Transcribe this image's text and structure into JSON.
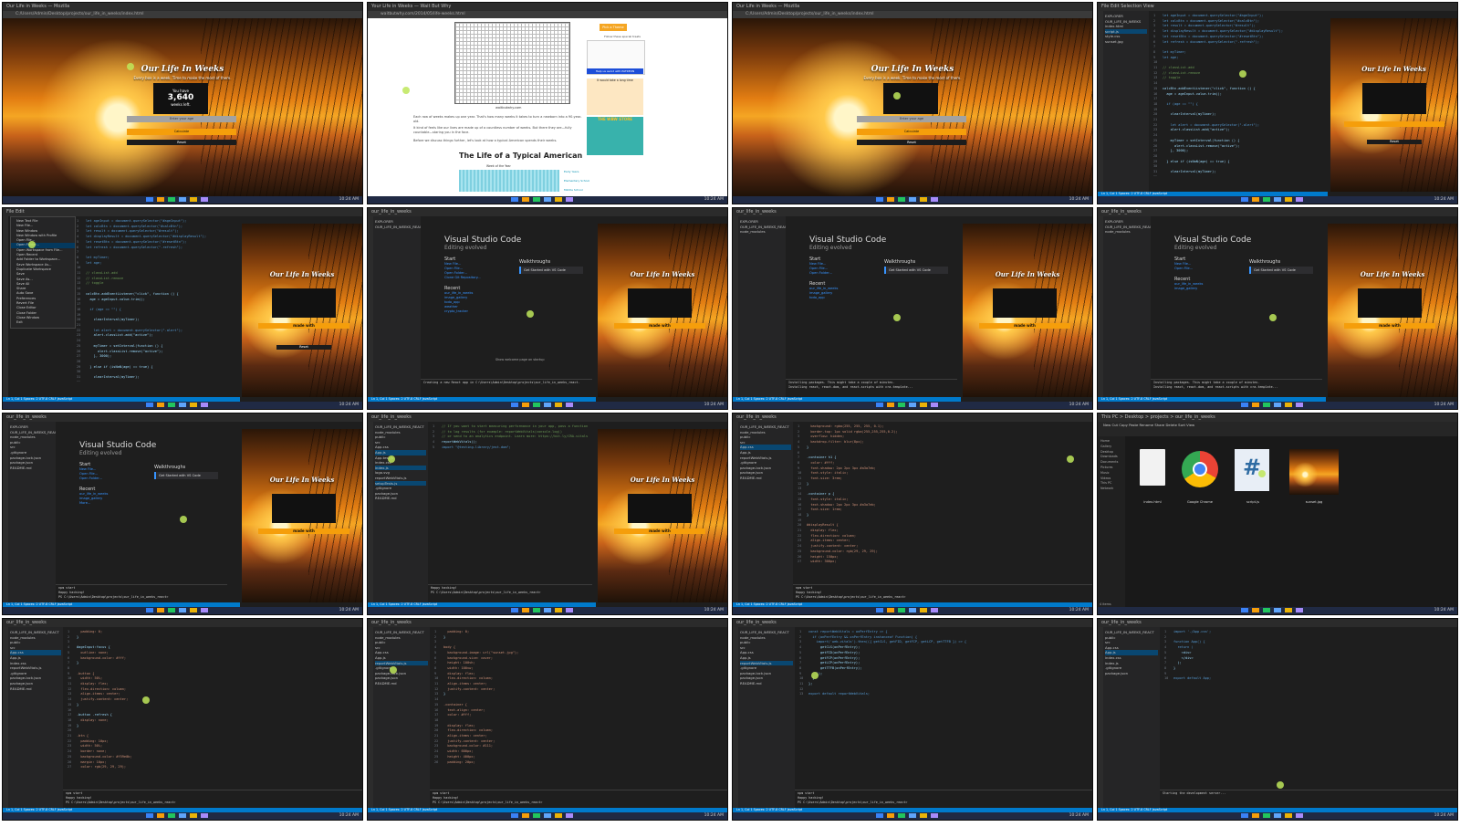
{
  "app": {
    "title": "Our Life In Weeks",
    "subtitle": "Every box is a week. Time to make the most of them.",
    "weeks_label": "You have",
    "weeks_value": "3,640",
    "weeks_suffix": "weeks left.",
    "input_placeholder": "Enter your age",
    "submit_label": "Calculate",
    "reset_label": "Reset",
    "title_alt": "Our Life In Weeks",
    "made_with": "made with"
  },
  "browser": {
    "tab_title": "Our Life in Weeks — Mozilla",
    "tab_title_2": "Your Life in Weeks — Wait But Why",
    "url_local": "C:/Users/Admin/Desktop/projects/our_life_in_weeks/index.html",
    "url_article": "waitbutwhy.com/2014/05/life-weeks.html",
    "article_caption": "waitbutwhy.com",
    "article_text_1": "Each row of weeks makes up one year. That's how many weeks it takes to turn a newborn into a 90-year-old.",
    "article_text_2": "It kind of feels like our lives are made up of a countless number of weeks. But there they are—fully countable—staring you in the face.",
    "article_text_3": "Before we discuss things further, let's look at how a typical American spends their weeks.",
    "article_heading": "The Life of a Typical American",
    "article_axis_label": "Week of the Year",
    "article_legend_1": "Early Years",
    "article_legend_2": "Elementary School",
    "article_legend_3": "Middle School",
    "side_banner": "Pick a Theme",
    "side_comic_caption": "Help us avoid with PATREON",
    "side_comic_2": "It would take a long time",
    "side_store": "THE WBW STORE",
    "side_tagline": "Follow these special treats"
  },
  "vscode": {
    "menu": [
      "File",
      "Edit",
      "Selection",
      "View",
      "Go",
      "Run",
      "Terminal",
      "Help"
    ],
    "search_placeholder": "our_life_in_weeks",
    "explorer_title": "EXPLORER",
    "project_name": "OUR_LIFE_IN_WEEKS_REACT",
    "project_name_2": "OUR_LIFE_IN_WEEKS",
    "files_root": [
      "index.html",
      "script.js",
      "style.css",
      "sunset.jpg"
    ],
    "files_react": [
      "node_modules",
      "public",
      "src",
      "App.css",
      "App.js",
      "App.test.js",
      "index.css",
      "index.js",
      "logo.svg",
      "reportWebVitals.js",
      "setupTests.js",
      ".gitignore",
      "package-lock.json",
      "package.json",
      "README.md"
    ],
    "outline": "OUTLINE",
    "timeline": "TIMELINE",
    "welcome_title": "Visual Studio Code",
    "welcome_sub": "Editing evolved",
    "start": "Start",
    "start_items": [
      "New File...",
      "Open File...",
      "Open Folder...",
      "Clone Git Repository..."
    ],
    "recent": "Recent",
    "recent_items": [
      "our_life_in_weeks",
      "image_gallery",
      "todo_app",
      "weather",
      "crypto_tracker"
    ],
    "more": "More...",
    "walkthroughs": "Walkthroughs",
    "walk_card_title": "Get Started with VS Code",
    "walk_card_text": "Customize your editor, learn the basics, and start coding",
    "show_welcome": "Show welcome page on startup",
    "terminal_tabs": [
      "PROBLEMS",
      "OUTPUT",
      "DEBUG CONSOLE",
      "TERMINAL",
      "PORTS"
    ],
    "term_1": "Creating a new React app in C:\\Users\\Admin\\Desktop\\projects\\our_life_in_weeks_react.",
    "term_2": "Installing packages. This might take a couple of minutes.",
    "term_3": "Installing react, react-dom, and react-scripts with cra-template...",
    "term_4": "Happy hacking!",
    "term_5": "PS C:\\Users\\Admin\\Desktop\\projects\\our_life_in_weeks_react>",
    "term_6": "npm start",
    "term_7": "Starting the development server...",
    "status_left": "main",
    "status_right": "Ln 1, Col 1   Spaces: 2   UTF-8   CRLF   JavaScript",
    "tab_files": [
      "App.js",
      "App.css",
      "index.js",
      "reportWebVitals.js",
      "setupTests.js"
    ],
    "file_menu": [
      "New Text File",
      "New File...",
      "New Window",
      "New Window with Profile",
      "Open File...",
      "Open Folder...",
      "Open Workspace from File...",
      "Open Recent",
      "Add Folder to Workspace...",
      "Save Workspace As...",
      "Duplicate Workspace",
      "Save",
      "Save As...",
      "Save All",
      "Share",
      "Auto Save",
      "Preferences",
      "Revert File",
      "Close Editor",
      "Close Folder",
      "Close Window",
      "Exit"
    ]
  },
  "code": {
    "script_js": [
      "let ageInput = document.querySelector(\"#ageInput\");",
      "let calcBtn = document.querySelector(\"#calcBtn\");",
      "let result = document.querySelector(\"#result\");",
      "let displayResult = document.querySelector(\"#displayResult\");",
      "let resetBtn = document.querySelector(\"#resetBtn\");",
      "let refresh = document.querySelector(\".refresh\");",
      "",
      "let myTimer;",
      "let age;",
      "",
      "// classList.add",
      "// classList.remove",
      "// toggle",
      "",
      "calcBtn.addEventListener(\"click\", function () {",
      "  age = ageInput.value.trim();",
      "",
      "  if (age == \"\") {",
      "",
      "    clearInterval(myTimer);",
      "",
      "    let alert = document.querySelector(\".alert\");",
      "    alert.classList.add(\"active\");",
      "",
      "    myTimer = setInterval(function () {",
      "      alert.classList.remove(\"active\");",
      "    }, 3000);",
      "",
      "  } else if (isNaN(age) == true) {",
      "",
      "    clearInterval(myTimer);",
      "",
      "    let alert = document.querySelector(\".alert\");"
    ],
    "app_js_comment": [
      "// If you want to start measuring performance in your app, pass a function",
      "// to log results (for example: reportWebVitals(console.log))",
      "// or send to an analytics endpoint. Learn more: https://bit.ly/CRA-vitals",
      "reportWebVitals();",
      "import \"@testing-library/jest-dom\";"
    ],
    "css_a": [
      "  background: rgba(255, 255, 255, 0.1);",
      "  border-top: 1px solid rgba(255,255,255,0.2);",
      "  overflow: hidden;",
      "  backdrop-filter: blur(8px);",
      "}",
      "",
      ".container h1 {",
      "  color: #fff;",
      "  font-shadow: 2px 2px 3px #a3a7eb;",
      "  font-style: italic;",
      "  font-size: 3rem;",
      "}",
      "",
      ".container p {",
      "  font-style: italic;",
      "  text-shadow: 2px 2px 3px #a3a7eb;",
      "  font-size: 1rem;",
      "}",
      "",
      "#displayResult {",
      "  display: flex;",
      "  flex-direction: column;",
      "  align-items: center;",
      "  justify-content: center;",
      "  background-color: rgb(29, 29, 29);",
      "  height: 150px;",
      "  width: 300px;"
    ],
    "css_b": [
      "  padding: 0;",
      "}",
      "",
      "#ageInput:focus {",
      "  outline: none;",
      "  background-color: #fff;",
      "}",
      "",
      ".button {",
      "  width: 50%;",
      "  display: flex;",
      "  flex-direction: column;",
      "  align-items: center;",
      "  justify-content: center;",
      "}",
      "",
      ".button .refresh {",
      "  display: none;",
      "}",
      "",
      ".btn {",
      "  padding: 10px;",
      "  width: 50%;",
      "  border: none;",
      "  background-color: #f59e0b;",
      "  margin: 10px;",
      "  color: rgb(29, 29, 29);"
    ],
    "css_c": [
      "  padding: 0;",
      "}",
      "",
      "body {",
      "  background-image: url(\"sunset.jpg\");",
      "  background-size: cover;",
      "  height: 100vh;",
      "  width: 100vw;",
      "  display: flex;",
      "  flex-direction: column;",
      "  align-items: center;",
      "  justify-content: center;",
      "}",
      "",
      ".container {",
      "  text-align: center;",
      "  color: #fff;",
      "",
      "  display: flex;",
      "  flex-direction: column;",
      "  align-items: center;",
      "  justify-content: center;",
      "  background-color: #111;",
      "  width: 600px;",
      "  height: 400px;",
      "  padding: 20px;"
    ],
    "vitals_js": [
      "const reportWebVitals = onPerfEntry => {",
      "  if (onPerfEntry && onPerfEntry instanceof Function) {",
      "    import('web-vitals').then(({ getCLS, getFID, getFCP, getLCP, getTTFB }) => {",
      "      getCLS(onPerfEntry);",
      "      getFID(onPerfEntry);",
      "      getFCP(onPerfEntry);",
      "      getLCP(onPerfEntry);",
      "      getTTFB(onPerfEntry);",
      "    });",
      "  }",
      "};",
      "",
      "export default reportWebVitals;"
    ],
    "app_min": [
      "import './App.css';",
      "",
      "function App() {",
      "  return (",
      "    <div>",
      "    </div>",
      "  );",
      "}",
      "",
      "export default App;"
    ]
  },
  "explorer_window": {
    "path": "This PC > Desktop > projects > our_life_in_weeks",
    "toolbar": "New   Cut   Copy   Paste   Rename   Share   Delete   Sort   View",
    "sidebar": [
      "Home",
      "Gallery",
      "Desktop",
      "Downloads",
      "Documents",
      "Pictures",
      "Music",
      "Videos",
      "This PC",
      "Network"
    ],
    "files": [
      "index.html",
      "Google Chrome",
      "script.js",
      "sunset.jpg"
    ],
    "status": "4 items"
  },
  "taskbar": {
    "time": "10:24 AM"
  }
}
